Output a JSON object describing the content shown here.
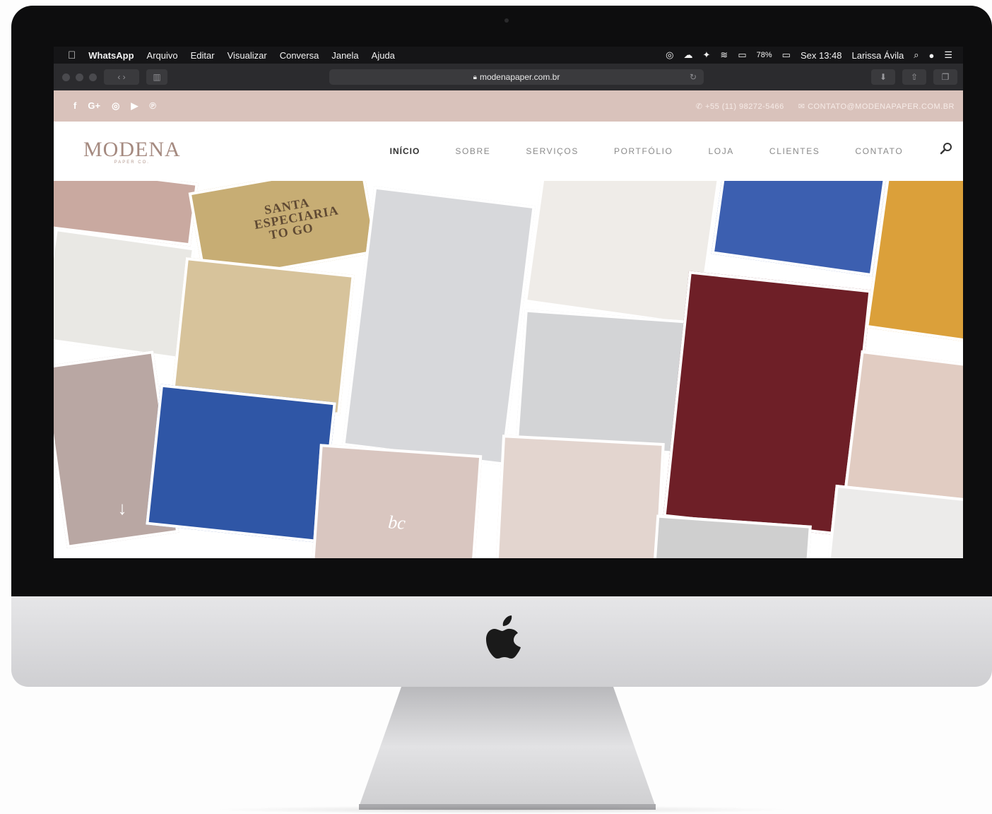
{
  "menubar": {
    "app_name": "WhatsApp",
    "menus": [
      "Arquivo",
      "Editar",
      "Visualizar",
      "Conversa",
      "Janela",
      "Ajuda"
    ],
    "battery": "78%",
    "clock": "Sex 13:48",
    "user": "Larissa Ávila"
  },
  "browser": {
    "url": "modenapaper.com.br"
  },
  "site": {
    "phone": "+55 (11) 98272-5466",
    "email": "CONTATO@MODENAPAPER.COM.BR",
    "social": [
      "f",
      "G+",
      "◎",
      "▶",
      "℗"
    ],
    "logo_text": "MODENA",
    "logo_sub": "PAPER CO.",
    "nav": [
      "INÍCIO",
      "SOBRE",
      "SERVIÇOS",
      "PORTFÓLIO",
      "LOJA",
      "CLIENTES",
      "CONTATO"
    ],
    "active_nav": "INÍCIO",
    "hero_tile_text": [
      "SANTA ESPECIARIA TO GO",
      "bc"
    ],
    "scroll_arrow": "↓"
  },
  "colors": {
    "topbar": "#d9c2bb",
    "logo": "#a58a80",
    "accent": "#7a2630"
  }
}
